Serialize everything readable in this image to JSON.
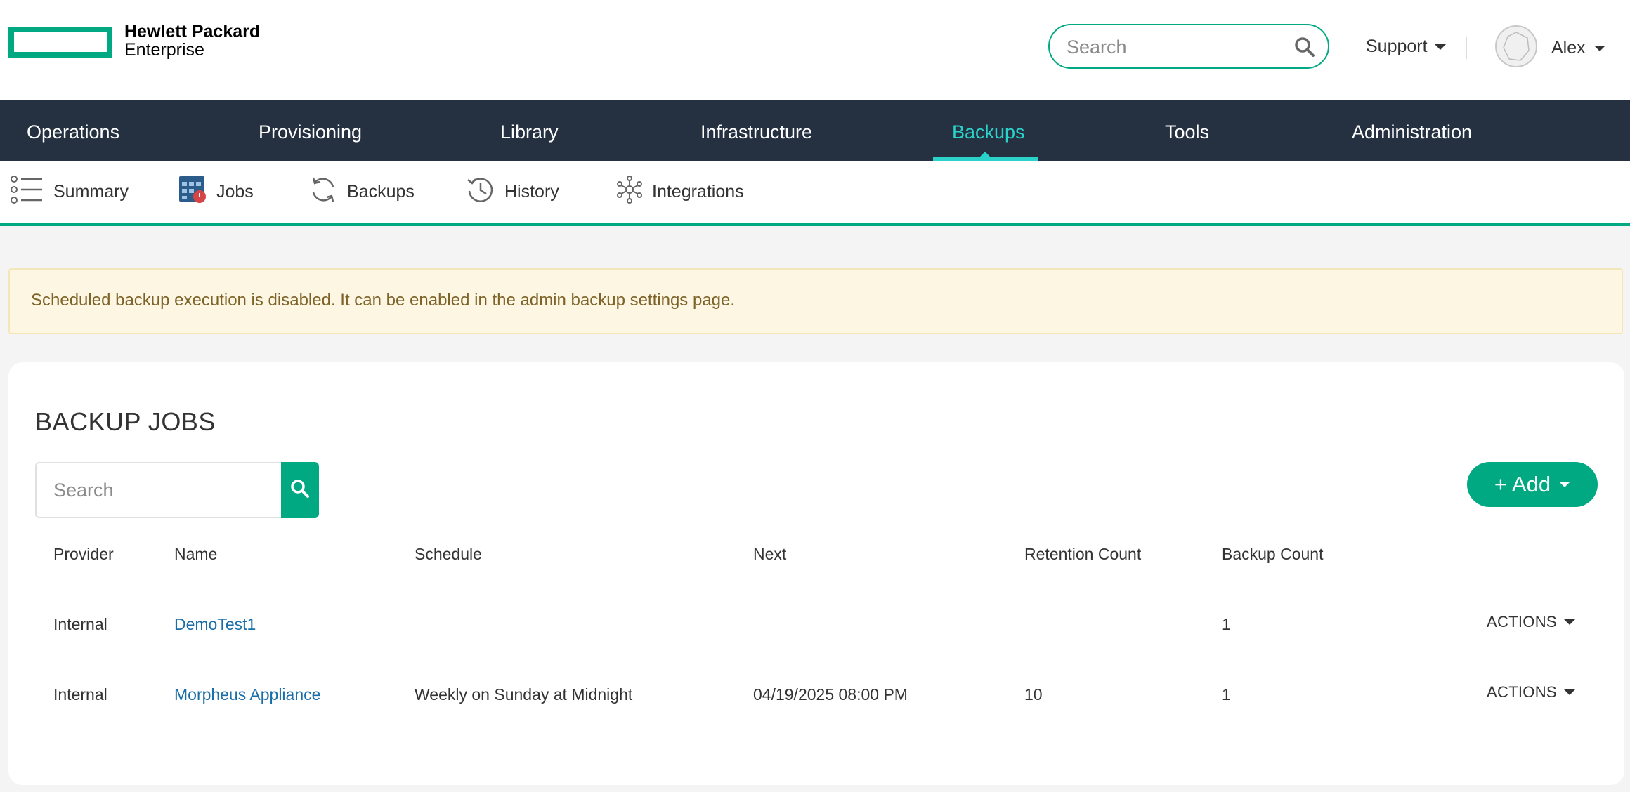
{
  "header": {
    "logo_line1": "Hewlett Packard",
    "logo_line2": "Enterprise",
    "search_placeholder": "Search",
    "support_label": "Support",
    "user_name": "Alex"
  },
  "main_nav": {
    "active": "Backups",
    "items": [
      "Operations",
      "Provisioning",
      "Library",
      "Infrastructure",
      "Backups",
      "Tools",
      "Administration"
    ]
  },
  "sub_nav": {
    "active": "Jobs",
    "items": [
      "Summary",
      "Jobs",
      "Backups",
      "History",
      "Integrations"
    ]
  },
  "alert": {
    "message": "Scheduled backup execution is disabled. It can be enabled in the admin backup settings page."
  },
  "backup_jobs": {
    "title": "BACKUP JOBS",
    "search_placeholder": "Search",
    "add_label": "+ Add",
    "columns": [
      "Provider",
      "Name",
      "Schedule",
      "Next",
      "Retention Count",
      "Backup Count"
    ],
    "rows": [
      {
        "provider": "Internal",
        "name": "DemoTest1",
        "schedule": "",
        "next": "",
        "retention_count": "",
        "backup_count": "1",
        "actions": "ACTIONS"
      },
      {
        "provider": "Internal",
        "name": "Morpheus Appliance",
        "schedule": "Weekly on Sunday at Midnight",
        "next": "04/19/2025 08:00 PM",
        "retention_count": "10",
        "backup_count": "1",
        "actions": "ACTIONS"
      }
    ]
  },
  "colors": {
    "brand_green": "#01a982",
    "nav_bg": "#253040",
    "nav_active": "#2ad2c9",
    "link": "#1a6ea8",
    "alert_bg": "#fdf6e3",
    "alert_text": "#7d6328"
  }
}
